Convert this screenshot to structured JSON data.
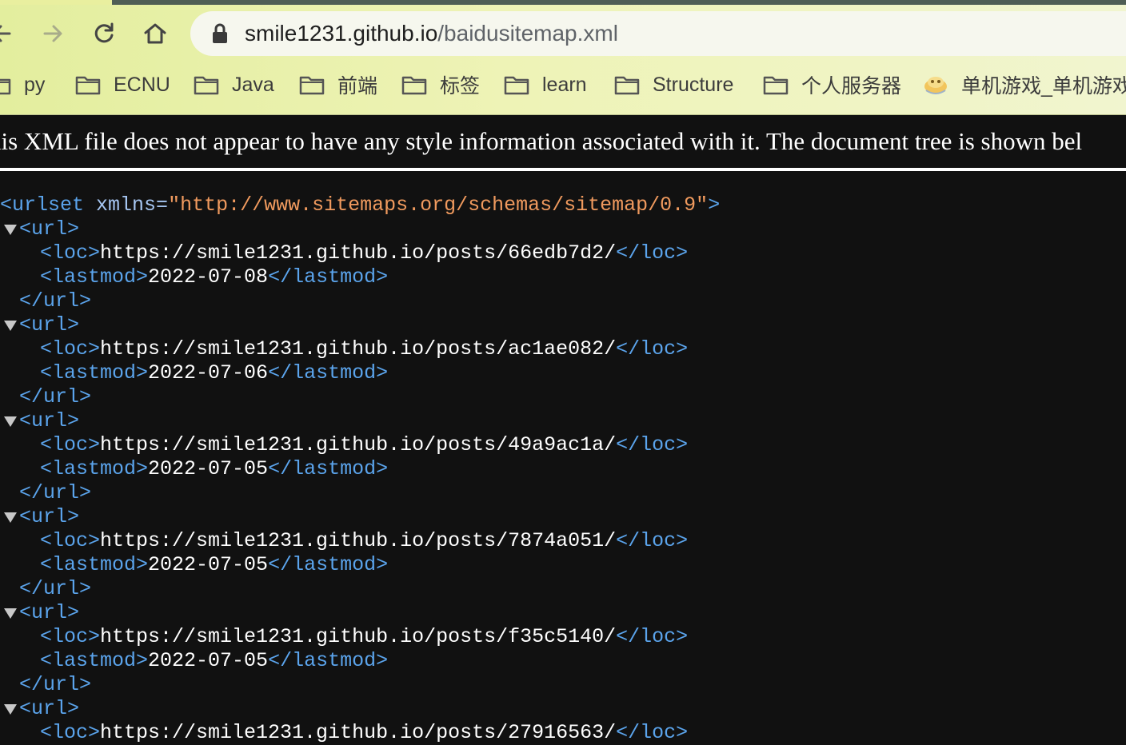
{
  "browser": {
    "url_host": "smile1231.github.io",
    "url_path": "/baidusitemap.xml",
    "icons": [
      "back-arrow-icon",
      "forward-arrow-icon",
      "reload-icon",
      "home-icon",
      "lock-icon",
      "folder-icon"
    ]
  },
  "bookmarks": [
    {
      "label": "py",
      "icon": "folder-icon"
    },
    {
      "label": "ECNU",
      "icon": "folder-icon"
    },
    {
      "label": "Java",
      "icon": "folder-icon"
    },
    {
      "label": "前端",
      "icon": "folder-icon"
    },
    {
      "label": "标签",
      "icon": "folder-icon"
    },
    {
      "label": "learn",
      "icon": "folder-icon"
    },
    {
      "label": "Structure",
      "icon": "folder-icon"
    },
    {
      "label": "个人服务器",
      "icon": "folder-icon"
    },
    {
      "label": "单机游戏_单机游戏",
      "icon": "game-site-icon"
    }
  ],
  "xml_notice": "his XML file does not appear to have any style information associated with it. The document tree is shown bel",
  "xml": {
    "root_open": "<urlset",
    "xmlns_attr": " xmlns=",
    "xmlns_value": "\"http://www.sitemaps.org/schemas/sitemap/0.9\"",
    "root_close_bracket": ">",
    "url_open": "<url>",
    "url_close": "</url>",
    "loc_open": "<loc>",
    "loc_close": "</loc>",
    "lastmod_open": "<lastmod>",
    "lastmod_close": "</lastmod>",
    "entries": [
      {
        "loc": "https://smile1231.github.io/posts/66edb7d2/",
        "lastmod": "2022-07-08"
      },
      {
        "loc": "https://smile1231.github.io/posts/ac1ae082/",
        "lastmod": "2022-07-06"
      },
      {
        "loc": "https://smile1231.github.io/posts/49a9ac1a/",
        "lastmod": "2022-07-05"
      },
      {
        "loc": "https://smile1231.github.io/posts/7874a051/",
        "lastmod": "2022-07-05"
      },
      {
        "loc": "https://smile1231.github.io/posts/f35c5140/",
        "lastmod": "2022-07-05"
      }
    ],
    "partial_next_loc": "https://smile1231.github.io/posts/27916563/"
  },
  "colors": {
    "tag": "#5ba4ec",
    "attr_value": "#f09a5e",
    "background": "#111111",
    "toolbar": "#e3ee9e"
  }
}
